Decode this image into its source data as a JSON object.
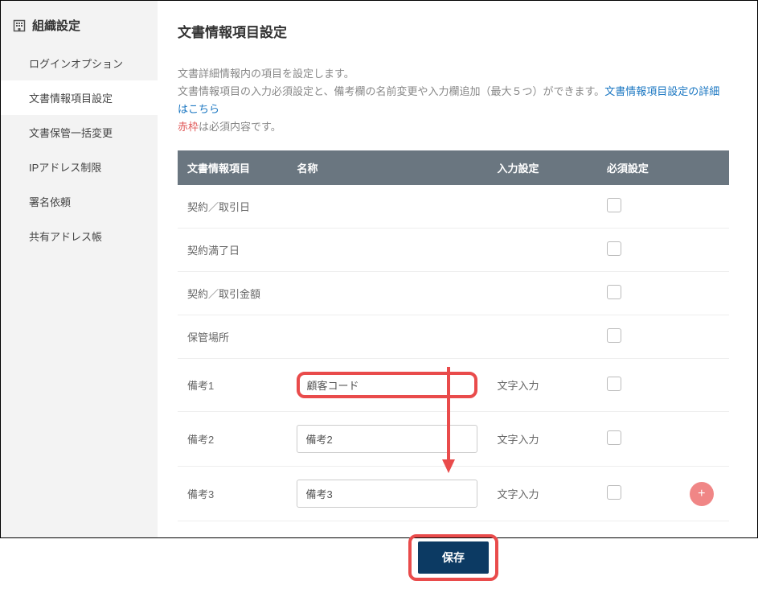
{
  "sidebar": {
    "title": "組織設定",
    "items": [
      {
        "label": "ログインオプション"
      },
      {
        "label": "文書情報項目設定"
      },
      {
        "label": "文書保管一括変更"
      },
      {
        "label": "IPアドレス制限"
      },
      {
        "label": "署名依頼"
      },
      {
        "label": "共有アドレス帳"
      }
    ],
    "active_index": 1
  },
  "page": {
    "title": "文書情報項目設定",
    "desc_line1": "文書詳細情報内の項目を設定します。",
    "desc_line2a": "文書情報項目の入力必須設定と、備考欄の名前変更や入力欄追加（最大５つ）ができます。",
    "desc_link": "文書情報項目設定の詳細はこちら",
    "desc_line3_red": "赤枠",
    "desc_line3_rest": "は必須内容です。"
  },
  "table": {
    "headers": {
      "item": "文書情報項目",
      "name": "名称",
      "input": "入力設定",
      "required": "必須設定"
    },
    "rows": [
      {
        "item": "契約／取引日",
        "name": "",
        "input": "",
        "name_editable": false
      },
      {
        "item": "契約満了日",
        "name": "",
        "input": "",
        "name_editable": false
      },
      {
        "item": "契約／取引金額",
        "name": "",
        "input": "",
        "name_editable": false
      },
      {
        "item": "保管場所",
        "name": "",
        "input": "",
        "name_editable": false
      },
      {
        "item": "備考1",
        "name": "顧客コード",
        "input": "文字入力",
        "name_editable": true,
        "highlight": true
      },
      {
        "item": "備考2",
        "name": "備考2",
        "input": "文字入力",
        "name_editable": true
      },
      {
        "item": "備考3",
        "name": "備考3",
        "input": "文字入力",
        "name_editable": true,
        "show_add": true
      }
    ]
  },
  "buttons": {
    "save": "保存"
  }
}
